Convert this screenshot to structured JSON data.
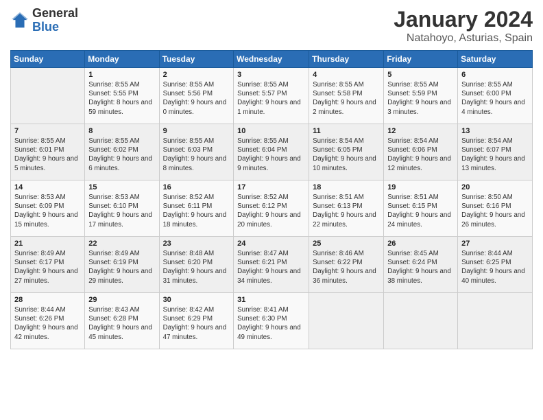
{
  "header": {
    "logo_general": "General",
    "logo_blue": "Blue",
    "month_title": "January 2024",
    "location": "Natahoyo, Asturias, Spain"
  },
  "weekdays": [
    "Sunday",
    "Monday",
    "Tuesday",
    "Wednesday",
    "Thursday",
    "Friday",
    "Saturday"
  ],
  "weeks": [
    [
      {
        "day": "",
        "sunrise": "",
        "sunset": "",
        "daylight": ""
      },
      {
        "day": "1",
        "sunrise": "Sunrise: 8:55 AM",
        "sunset": "Sunset: 5:55 PM",
        "daylight": "Daylight: 8 hours and 59 minutes."
      },
      {
        "day": "2",
        "sunrise": "Sunrise: 8:55 AM",
        "sunset": "Sunset: 5:56 PM",
        "daylight": "Daylight: 9 hours and 0 minutes."
      },
      {
        "day": "3",
        "sunrise": "Sunrise: 8:55 AM",
        "sunset": "Sunset: 5:57 PM",
        "daylight": "Daylight: 9 hours and 1 minute."
      },
      {
        "day": "4",
        "sunrise": "Sunrise: 8:55 AM",
        "sunset": "Sunset: 5:58 PM",
        "daylight": "Daylight: 9 hours and 2 minutes."
      },
      {
        "day": "5",
        "sunrise": "Sunrise: 8:55 AM",
        "sunset": "Sunset: 5:59 PM",
        "daylight": "Daylight: 9 hours and 3 minutes."
      },
      {
        "day": "6",
        "sunrise": "Sunrise: 8:55 AM",
        "sunset": "Sunset: 6:00 PM",
        "daylight": "Daylight: 9 hours and 4 minutes."
      }
    ],
    [
      {
        "day": "7",
        "sunrise": "Sunrise: 8:55 AM",
        "sunset": "Sunset: 6:01 PM",
        "daylight": "Daylight: 9 hours and 5 minutes."
      },
      {
        "day": "8",
        "sunrise": "Sunrise: 8:55 AM",
        "sunset": "Sunset: 6:02 PM",
        "daylight": "Daylight: 9 hours and 6 minutes."
      },
      {
        "day": "9",
        "sunrise": "Sunrise: 8:55 AM",
        "sunset": "Sunset: 6:03 PM",
        "daylight": "Daylight: 9 hours and 8 minutes."
      },
      {
        "day": "10",
        "sunrise": "Sunrise: 8:55 AM",
        "sunset": "Sunset: 6:04 PM",
        "daylight": "Daylight: 9 hours and 9 minutes."
      },
      {
        "day": "11",
        "sunrise": "Sunrise: 8:54 AM",
        "sunset": "Sunset: 6:05 PM",
        "daylight": "Daylight: 9 hours and 10 minutes."
      },
      {
        "day": "12",
        "sunrise": "Sunrise: 8:54 AM",
        "sunset": "Sunset: 6:06 PM",
        "daylight": "Daylight: 9 hours and 12 minutes."
      },
      {
        "day": "13",
        "sunrise": "Sunrise: 8:54 AM",
        "sunset": "Sunset: 6:07 PM",
        "daylight": "Daylight: 9 hours and 13 minutes."
      }
    ],
    [
      {
        "day": "14",
        "sunrise": "Sunrise: 8:53 AM",
        "sunset": "Sunset: 6:09 PM",
        "daylight": "Daylight: 9 hours and 15 minutes."
      },
      {
        "day": "15",
        "sunrise": "Sunrise: 8:53 AM",
        "sunset": "Sunset: 6:10 PM",
        "daylight": "Daylight: 9 hours and 17 minutes."
      },
      {
        "day": "16",
        "sunrise": "Sunrise: 8:52 AM",
        "sunset": "Sunset: 6:11 PM",
        "daylight": "Daylight: 9 hours and 18 minutes."
      },
      {
        "day": "17",
        "sunrise": "Sunrise: 8:52 AM",
        "sunset": "Sunset: 6:12 PM",
        "daylight": "Daylight: 9 hours and 20 minutes."
      },
      {
        "day": "18",
        "sunrise": "Sunrise: 8:51 AM",
        "sunset": "Sunset: 6:13 PM",
        "daylight": "Daylight: 9 hours and 22 minutes."
      },
      {
        "day": "19",
        "sunrise": "Sunrise: 8:51 AM",
        "sunset": "Sunset: 6:15 PM",
        "daylight": "Daylight: 9 hours and 24 minutes."
      },
      {
        "day": "20",
        "sunrise": "Sunrise: 8:50 AM",
        "sunset": "Sunset: 6:16 PM",
        "daylight": "Daylight: 9 hours and 26 minutes."
      }
    ],
    [
      {
        "day": "21",
        "sunrise": "Sunrise: 8:49 AM",
        "sunset": "Sunset: 6:17 PM",
        "daylight": "Daylight: 9 hours and 27 minutes."
      },
      {
        "day": "22",
        "sunrise": "Sunrise: 8:49 AM",
        "sunset": "Sunset: 6:19 PM",
        "daylight": "Daylight: 9 hours and 29 minutes."
      },
      {
        "day": "23",
        "sunrise": "Sunrise: 8:48 AM",
        "sunset": "Sunset: 6:20 PM",
        "daylight": "Daylight: 9 hours and 31 minutes."
      },
      {
        "day": "24",
        "sunrise": "Sunrise: 8:47 AM",
        "sunset": "Sunset: 6:21 PM",
        "daylight": "Daylight: 9 hours and 34 minutes."
      },
      {
        "day": "25",
        "sunrise": "Sunrise: 8:46 AM",
        "sunset": "Sunset: 6:22 PM",
        "daylight": "Daylight: 9 hours and 36 minutes."
      },
      {
        "day": "26",
        "sunrise": "Sunrise: 8:45 AM",
        "sunset": "Sunset: 6:24 PM",
        "daylight": "Daylight: 9 hours and 38 minutes."
      },
      {
        "day": "27",
        "sunrise": "Sunrise: 8:44 AM",
        "sunset": "Sunset: 6:25 PM",
        "daylight": "Daylight: 9 hours and 40 minutes."
      }
    ],
    [
      {
        "day": "28",
        "sunrise": "Sunrise: 8:44 AM",
        "sunset": "Sunset: 6:26 PM",
        "daylight": "Daylight: 9 hours and 42 minutes."
      },
      {
        "day": "29",
        "sunrise": "Sunrise: 8:43 AM",
        "sunset": "Sunset: 6:28 PM",
        "daylight": "Daylight: 9 hours and 45 minutes."
      },
      {
        "day": "30",
        "sunrise": "Sunrise: 8:42 AM",
        "sunset": "Sunset: 6:29 PM",
        "daylight": "Daylight: 9 hours and 47 minutes."
      },
      {
        "day": "31",
        "sunrise": "Sunrise: 8:41 AM",
        "sunset": "Sunset: 6:30 PM",
        "daylight": "Daylight: 9 hours and 49 minutes."
      },
      {
        "day": "",
        "sunrise": "",
        "sunset": "",
        "daylight": ""
      },
      {
        "day": "",
        "sunrise": "",
        "sunset": "",
        "daylight": ""
      },
      {
        "day": "",
        "sunrise": "",
        "sunset": "",
        "daylight": ""
      }
    ]
  ]
}
